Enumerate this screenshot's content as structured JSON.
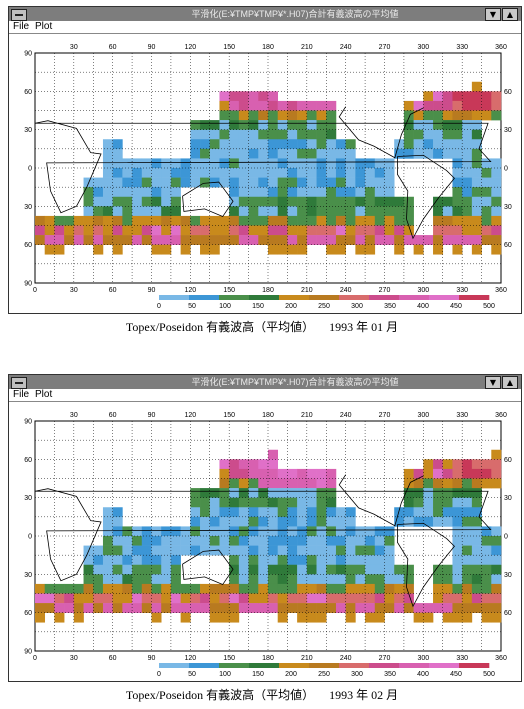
{
  "windows": [
    {
      "title": "平滑化(E:¥TMP¥TMP¥*.H07)合計有義波高の平均値",
      "menu": [
        "File",
        "Plot"
      ],
      "controls": {
        "minimize": "▼",
        "maximize": "▲"
      },
      "top_axis": [
        "30",
        "60",
        "90",
        "120",
        "150",
        "180",
        "210",
        "240",
        "270",
        "300",
        "330",
        "360"
      ],
      "bottom_axis": [
        "0",
        "30",
        "60",
        "90",
        "120",
        "150",
        "180",
        "210",
        "240",
        "270",
        "300",
        "330",
        "360"
      ],
      "left_axis": [
        "90",
        "60",
        "30",
        "0",
        "30",
        "60",
        "90"
      ],
      "right_axis": [
        "60",
        "30",
        "0",
        "30",
        "60"
      ],
      "legend_ticks": [
        "0",
        "50",
        "100",
        "150",
        "200",
        "250",
        "300",
        "350",
        "400",
        "450",
        "500"
      ],
      "caption": {
        "dataset": "Topex/Poseidon 有義波高（平均値）",
        "date": "1993 年 01 月"
      },
      "month": 1
    },
    {
      "title": "平滑化(E:¥TMP¥TMP¥*.H07)合計有義波高の平均値",
      "menu": [
        "File",
        "Plot"
      ],
      "controls": {
        "minimize": "▼",
        "maximize": "▲"
      },
      "top_axis": [
        "30",
        "60",
        "90",
        "120",
        "150",
        "180",
        "210",
        "240",
        "270",
        "300",
        "330",
        "360"
      ],
      "bottom_axis": [
        "0",
        "30",
        "60",
        "90",
        "120",
        "150",
        "180",
        "210",
        "240",
        "270",
        "300",
        "330",
        "360"
      ],
      "left_axis": [
        "90",
        "60",
        "30",
        "0",
        "30",
        "60",
        "90"
      ],
      "right_axis": [
        "60",
        "30",
        "0",
        "30",
        "60"
      ],
      "legend_ticks": [
        "0",
        "50",
        "100",
        "150",
        "200",
        "250",
        "300",
        "350",
        "400",
        "450",
        "500"
      ],
      "caption": {
        "dataset": "Topex/Poseidon 有義波高（平均値）",
        "date": "1993 年 02 月"
      },
      "month": 2
    }
  ],
  "colors": {
    "titlebar": "#7d7d7d",
    "scale": [
      "#ffffff",
      "#79b8e6",
      "#3c96d6",
      "#4a8f4a",
      "#2f7a3a",
      "#c88a1c",
      "#b87a20",
      "#d86c6c",
      "#cc4c8c",
      "#d860b0",
      "#e070c8",
      "#c83858"
    ]
  }
}
